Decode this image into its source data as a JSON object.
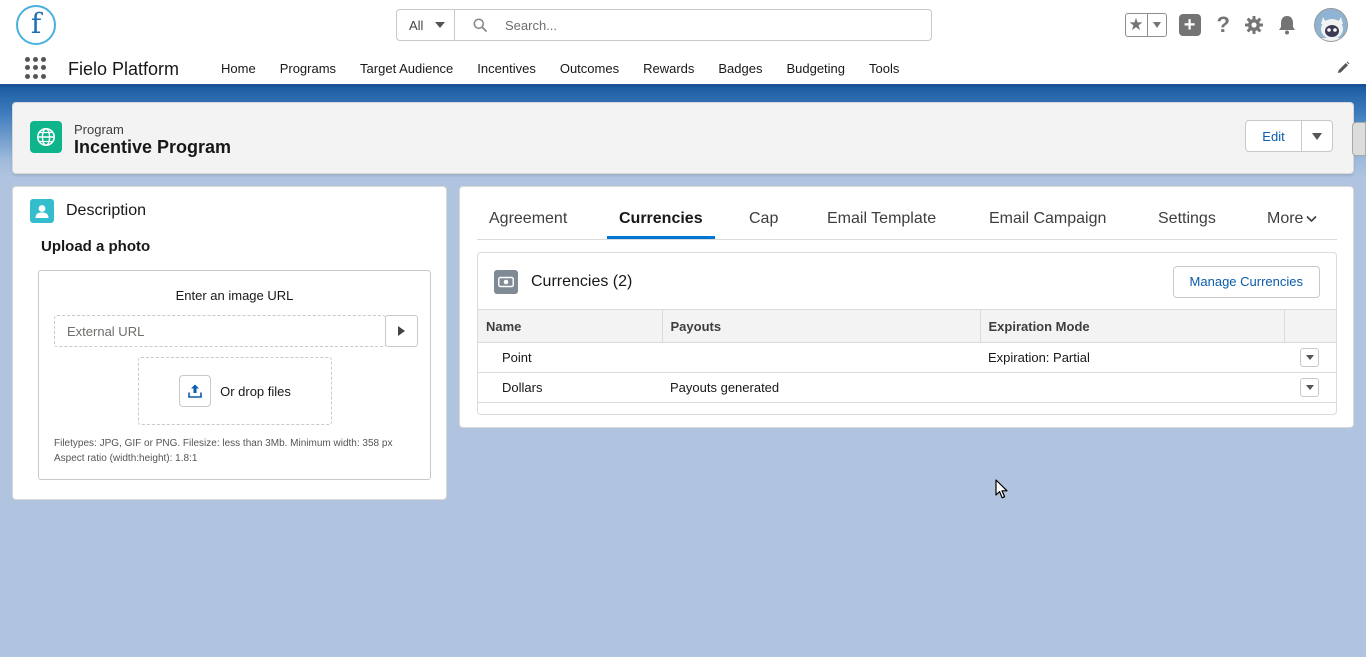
{
  "header": {
    "logo_letter": "f",
    "search_scope": "All",
    "search_placeholder": "Search..."
  },
  "nav": {
    "app_name": "Fielo Platform",
    "items": [
      "Home",
      "Programs",
      "Target Audience",
      "Incentives",
      "Outcomes",
      "Rewards",
      "Badges",
      "Budgeting",
      "Tools"
    ]
  },
  "record": {
    "type": "Program",
    "title": "Incentive Program",
    "edit_label": "Edit"
  },
  "description": {
    "title": "Description",
    "upload_title": "Upload a photo",
    "url_label": "Enter an image URL",
    "url_placeholder": "External URL",
    "drop_label": "Or drop files",
    "file_info_line1": "Filetypes: JPG, GIF or PNG. Filesize: less than 3Mb. Minimum width: 358 px",
    "file_info_line2": "Aspect ratio (width:height): 1.8:1"
  },
  "tabs": [
    "Agreement",
    "Currencies",
    "Cap",
    "Email Template",
    "Email Campaign",
    "Settings",
    "More"
  ],
  "currencies": {
    "title": "Currencies (2)",
    "manage_label": "Manage Currencies",
    "columns": [
      "Name",
      "Payouts",
      "Expiration Mode"
    ],
    "rows": [
      {
        "name": "Point",
        "payouts": "",
        "expiration": "Expiration: Partial"
      },
      {
        "name": "Dollars",
        "payouts": "Payouts generated",
        "expiration": ""
      }
    ]
  },
  "colors": {
    "brand_blue": "#1b5297",
    "accent_blue": "#0176d3",
    "program_icon": "#0eb58a",
    "description_icon": "#34becd",
    "background": "#b0c4df"
  }
}
